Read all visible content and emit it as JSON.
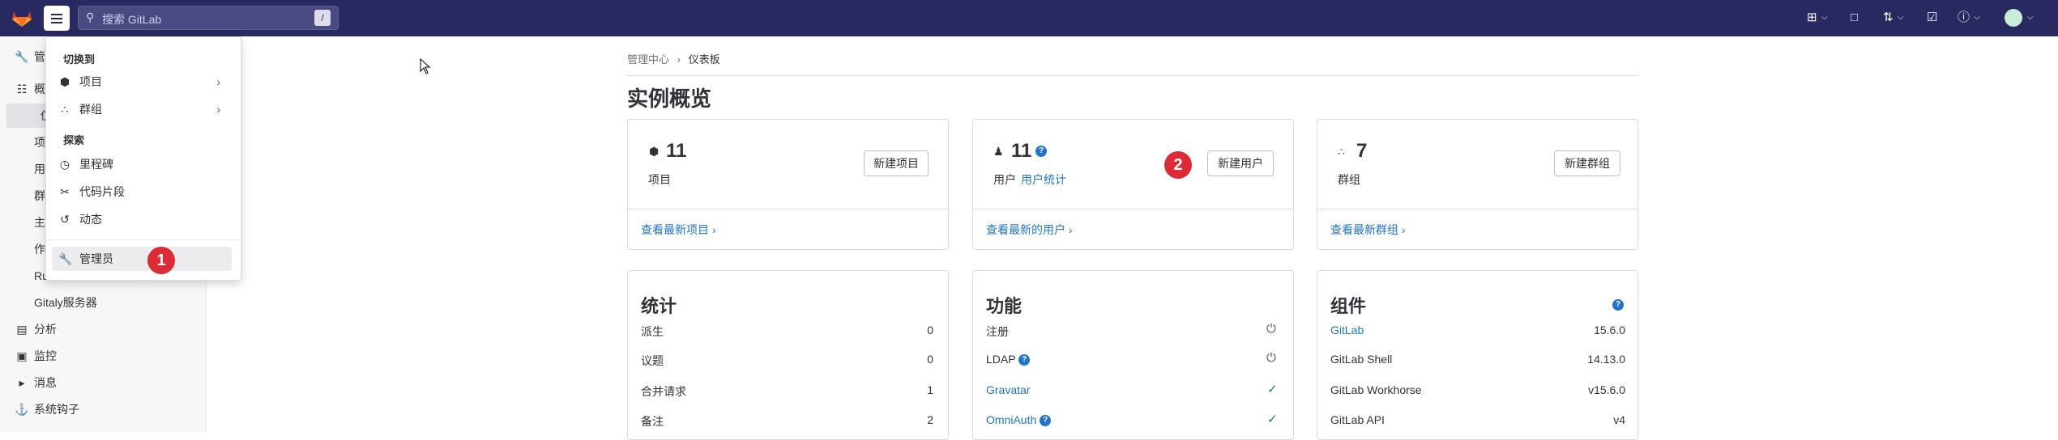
{
  "topbar": {
    "search_placeholder": "搜索 GitLab",
    "search_shortcut": "/",
    "icons": [
      "plus-square-icon",
      "chevron-down-icon",
      "issues-icon",
      "merge-request-icon",
      "chevron-down-icon",
      "todo-icon",
      "help-icon",
      "chevron-down-icon",
      "avatar"
    ]
  },
  "sidebar": {
    "items": [
      {
        "icon": "wrench-icon",
        "label": "管"
      },
      {
        "icon": "overview-icon",
        "label": "概"
      },
      {
        "label": "仪"
      },
      {
        "label": "项"
      },
      {
        "label": "用"
      },
      {
        "label": "群"
      },
      {
        "label": "主"
      },
      {
        "label": "作"
      },
      {
        "label": "Ru"
      },
      {
        "label": "Gitaly服务器"
      },
      {
        "icon": "chart-icon",
        "label": "分析"
      },
      {
        "icon": "monitor-icon",
        "label": "监控"
      },
      {
        "icon": "bullhorn-icon",
        "label": "消息"
      },
      {
        "icon": "hook-icon",
        "label": "系统钩子"
      }
    ]
  },
  "dropdown": {
    "switch_header": "切换到",
    "projects": "项目",
    "groups": "群组",
    "explore_header": "探索",
    "milestones": "里程碑",
    "snippets": "代码片段",
    "activity": "动态",
    "admin": "管理员",
    "marker1": "1"
  },
  "breadcrumb": {
    "root": "管理中心",
    "separator": "›",
    "current": "仪表板"
  },
  "page_title": "实例概览",
  "cards": {
    "projects": {
      "count": "11",
      "label": "项目",
      "button": "新建项目",
      "link": "查看最新项目"
    },
    "users": {
      "count": "11",
      "label": "用户",
      "stats_link": "用户统计",
      "button": "新建用户",
      "link": "查看最新的用户",
      "marker2": "2"
    },
    "groups": {
      "count": "7",
      "label": "群组",
      "button": "新建群组",
      "link": "查看最新群组"
    }
  },
  "statistics": {
    "title": "统计",
    "rows": [
      {
        "label": "派生",
        "value": "0"
      },
      {
        "label": "议题",
        "value": "0"
      },
      {
        "label": "合并请求",
        "value": "1"
      },
      {
        "label": "备注",
        "value": "2"
      }
    ]
  },
  "features": {
    "title": "功能",
    "rows": [
      {
        "label": "注册",
        "status": "power-icon"
      },
      {
        "label": "LDAP",
        "status": "power-icon"
      },
      {
        "label": "Gravatar",
        "status": "check-icon"
      },
      {
        "label": "OmniAuth",
        "status": "check-icon"
      }
    ]
  },
  "components": {
    "title": "组件",
    "rows": [
      {
        "label": "GitLab",
        "value": "15.6.0"
      },
      {
        "label": "GitLab Shell",
        "value": "14.13.0"
      },
      {
        "label": "GitLab Workhorse",
        "value": "v15.6.0"
      },
      {
        "label": "GitLab API",
        "value": "v4"
      }
    ]
  },
  "colors": {
    "topbar": "#292961",
    "link": "#1f75cb",
    "marker": "#dd2b36",
    "success": "#108548"
  }
}
